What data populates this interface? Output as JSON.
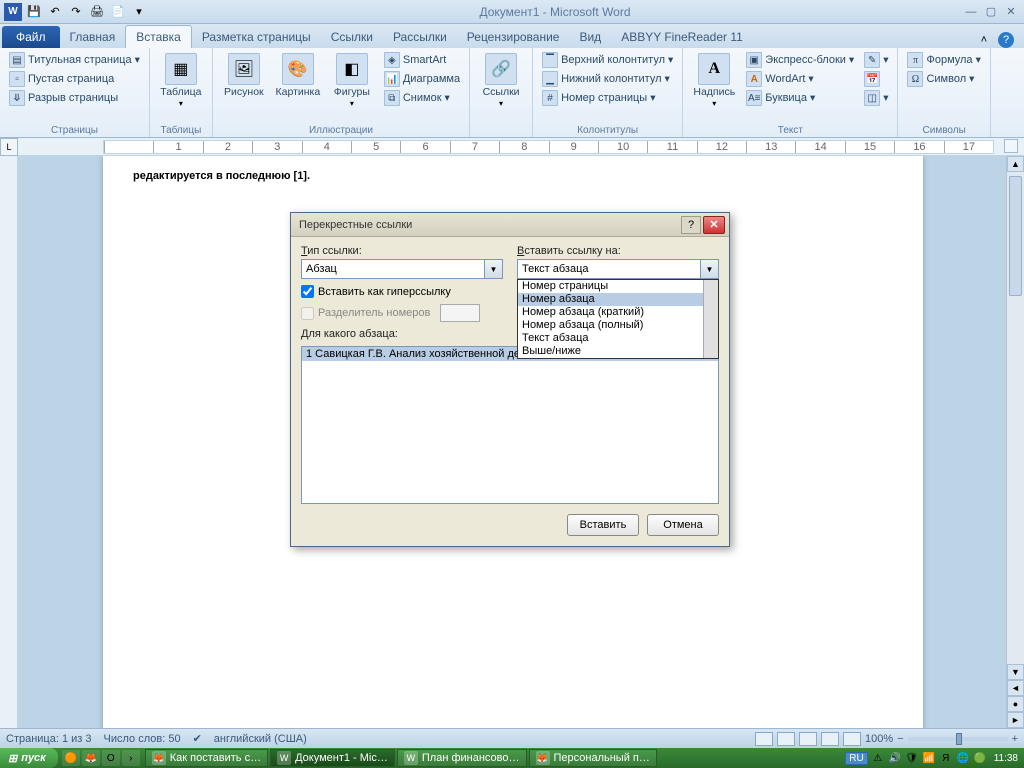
{
  "titlebar": {
    "title": "Документ1 - Microsoft Word"
  },
  "tabs": {
    "file": "Файл",
    "items": [
      "Главная",
      "Вставка",
      "Разметка страницы",
      "Ссылки",
      "Рассылки",
      "Рецензирование",
      "Вид",
      "ABBYY FineReader 11"
    ],
    "active": 1
  },
  "ribbon": {
    "groups": [
      {
        "label": "Страницы",
        "items": [
          {
            "label": "Титульная страница",
            "dd": true
          },
          {
            "label": "Пустая страница"
          },
          {
            "label": "Разрыв страницы"
          }
        ]
      },
      {
        "label": "Таблицы",
        "big": [
          {
            "label": "Таблица",
            "glyph": "▦"
          }
        ]
      },
      {
        "label": "Иллюстрации",
        "big": [
          {
            "label": "Рисунок",
            "glyph": "🖼"
          },
          {
            "label": "Картинка",
            "glyph": "🖼"
          },
          {
            "label": "Фигуры",
            "glyph": "◧"
          }
        ],
        "items": [
          {
            "label": "SmartArt"
          },
          {
            "label": "Диаграмма"
          },
          {
            "label": "Снимок",
            "dd": true
          }
        ]
      },
      {
        "label": "",
        "big": [
          {
            "label": "Ссылки",
            "glyph": "🔗"
          }
        ]
      },
      {
        "label": "Колонтитулы",
        "items": [
          {
            "label": "Верхний колонтитул",
            "dd": true
          },
          {
            "label": "Нижний колонтитул",
            "dd": true
          },
          {
            "label": "Номер страницы",
            "dd": true
          }
        ]
      },
      {
        "label": "Текст",
        "big": [
          {
            "label": "Надпись",
            "glyph": "A"
          }
        ],
        "items": [
          {
            "label": "Экспресс-блоки",
            "dd": true
          },
          {
            "label": "WordArt",
            "dd": true
          },
          {
            "label": "Буквица",
            "dd": true
          }
        ],
        "extras": true
      },
      {
        "label": "Символы",
        "items": [
          {
            "label": "Формула",
            "dd": true,
            "glyph": "π"
          },
          {
            "label": "Символ",
            "dd": true,
            "glyph": "Ω"
          }
        ]
      }
    ]
  },
  "document": {
    "text": "редактируется в последнюю [1]."
  },
  "dialog": {
    "title": "Перекрестные ссылки",
    "type_label": "Тип ссылки:",
    "type_value": "Абзац",
    "insert_as_label": "Вставить ссылку на:",
    "insert_as_value": "Текст абзаца",
    "hyperlink_label": "Вставить как гиперссылку",
    "separator_label": "Разделитель номеров",
    "for_which_label": "Для какого абзаца:",
    "list_items": [
      "1 Савицкая Г.В. Анализ хозяйственной де…"
    ],
    "dropdown_options": [
      "Номер страницы",
      "Номер абзаца",
      "Номер абзаца (краткий)",
      "Номер абзаца (полный)",
      "Текст абзаца",
      "Выше/ниже"
    ],
    "dropdown_highlight": 1,
    "btn_insert": "Вставить",
    "btn_cancel": "Отмена"
  },
  "statusbar": {
    "page": "Страница: 1 из 3",
    "words": "Число слов: 50",
    "lang": "английский (США)",
    "zoom": "100%"
  },
  "taskbar": {
    "start": "пуск",
    "tasks": [
      {
        "label": "Как поставить с…",
        "glyph": "🦊"
      },
      {
        "label": "Документ1 - Mic…",
        "glyph": "W",
        "active": true
      },
      {
        "label": "План финансово…",
        "glyph": "W"
      },
      {
        "label": "Персональный п…",
        "glyph": "🦊"
      }
    ],
    "lang": "RU",
    "clock": "11:38"
  }
}
